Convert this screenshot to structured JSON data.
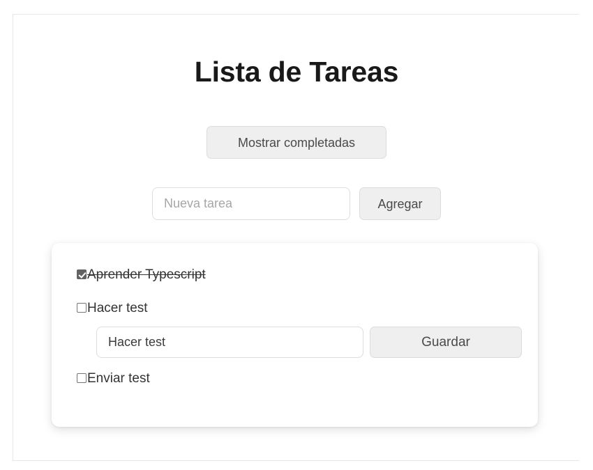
{
  "app": {
    "title": "Lista de Tareas"
  },
  "controls": {
    "show_completed_label": "Mostrar completadas",
    "new_task_placeholder": "Nueva tarea",
    "add_button_label": "Agregar"
  },
  "task_list": {
    "items": [
      {
        "label": "Aprender Typescript",
        "completed": true,
        "editing": false
      },
      {
        "label": "Hacer test",
        "completed": false,
        "editing": true,
        "edit_value": "Hacer test",
        "save_button_label": "Guardar"
      },
      {
        "label": "Enviar test",
        "completed": false,
        "editing": false
      }
    ]
  },
  "colors": {
    "page_background": "#ffffff",
    "frame_border": "#e7e7e7",
    "title_text": "#191919",
    "button_background": "#efefef",
    "button_border": "#dcdcdc",
    "button_text": "#4a4a4a",
    "input_border": "#dddddd",
    "placeholder_text": "#a6a6a6",
    "task_text": "#333333",
    "checkbox_checked_fill": "#636363",
    "card_background": "#ffffff"
  }
}
